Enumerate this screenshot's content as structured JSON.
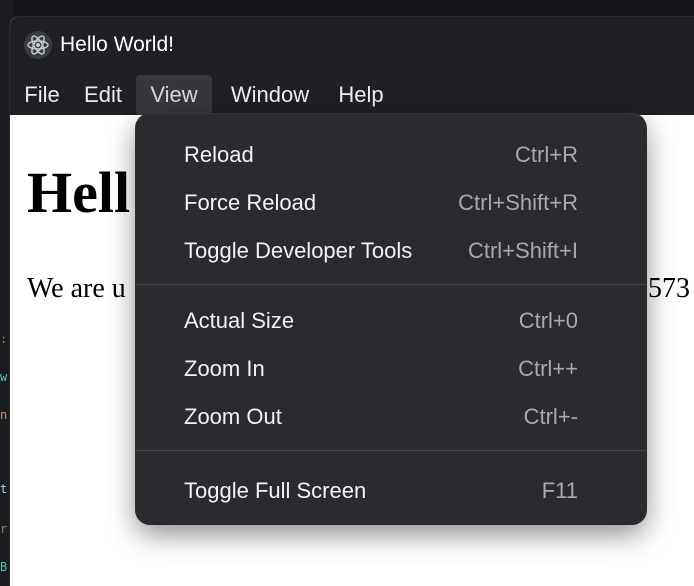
{
  "window": {
    "title": "Hello World!",
    "app_icon": "electron-atom-icon"
  },
  "menubar": {
    "items": [
      {
        "label": "File"
      },
      {
        "label": "Edit"
      },
      {
        "label": "View"
      },
      {
        "label": "Window"
      },
      {
        "label": "Help"
      }
    ],
    "active": "View"
  },
  "content": {
    "heading": "Hell",
    "paragraph_left": "We are u",
    "paragraph_right": "573"
  },
  "view_menu": {
    "groups": [
      [
        {
          "label": "Reload",
          "accelerator": "Ctrl+R"
        },
        {
          "label": "Force Reload",
          "accelerator": "Ctrl+Shift+R"
        },
        {
          "label": "Toggle Developer Tools",
          "accelerator": "Ctrl+Shift+I"
        }
      ],
      [
        {
          "label": "Actual Size",
          "accelerator": "Ctrl+0"
        },
        {
          "label": "Zoom In",
          "accelerator": "Ctrl++"
        },
        {
          "label": "Zoom Out",
          "accelerator": "Ctrl+-"
        }
      ],
      [
        {
          "label": "Toggle Full Screen",
          "accelerator": "F11"
        }
      ]
    ]
  },
  "colors": {
    "titlebar_bg": "#1f2023",
    "menu_bg": "#2b2b2f",
    "menu_text": "#f2f2f2",
    "accelerator_text": "#a9a9ad",
    "active_menu_bg": "#35373d"
  }
}
